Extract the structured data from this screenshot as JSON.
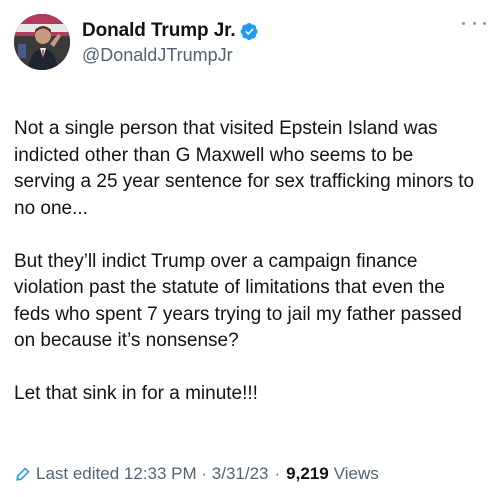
{
  "author": {
    "display_name": "Donald Trump Jr.",
    "handle": "@DonaldJTrumpJr",
    "verified": true,
    "verified_color": "#1d9bf0"
  },
  "tweet": {
    "paragraphs": [
      "Not a single person that visited Epstein Island was indicted other than G Maxwell who seems to be serving a 25 year sentence for sex trafficking minors to no one...",
      "But they’ll indict Trump over a campaign finance violation past the statute of limitations that even the feds who spent 7 years trying to jail my father passed on because it’s nonsense?",
      "Let that sink in for a minute!!!"
    ]
  },
  "meta": {
    "edited_label": "Last edited 12:33 PM · 3/31/23",
    "separator": "·",
    "views_count": "9,219",
    "views_label": "Views",
    "edited_color": "#1d9bf0"
  },
  "icons": {
    "verified": "verified-badge-icon",
    "more": "more-options-icon",
    "edit": "pencil-icon"
  }
}
